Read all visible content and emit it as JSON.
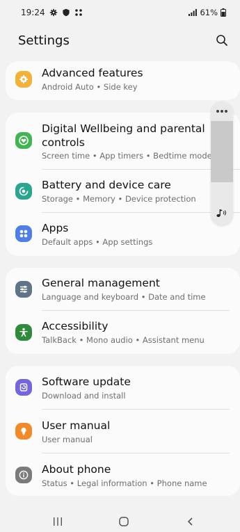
{
  "status_bar": {
    "time": "19:24",
    "battery": "61%"
  },
  "header": {
    "title": "Settings"
  },
  "settings": {
    "advanced": {
      "title": "Advanced features",
      "subtitle": "Android Auto  •  Side key"
    },
    "wellbeing": {
      "title_line1": "Digital Wellbeing and parental",
      "title_line2": "controls",
      "subtitle": "Screen time  •  App timers  •  Bedtime mode"
    },
    "battery": {
      "title": "Battery and device care",
      "subtitle": "Storage  •  Memory  •  Device protection"
    },
    "apps": {
      "title": "Apps",
      "subtitle": "Default apps  •  App settings"
    },
    "general": {
      "title": "General management",
      "subtitle": "Language and keyboard  •  Date and time"
    },
    "accessibility": {
      "title": "Accessibility",
      "subtitle": "TalkBack  •  Mono audio  •  Assistant menu"
    },
    "software": {
      "title": "Software update",
      "subtitle": "Download and install"
    },
    "manual": {
      "title": "User manual",
      "subtitle": "User manual"
    },
    "about": {
      "title": "About phone",
      "subtitle": "Status  •  Legal information  •  Phone name"
    }
  },
  "colors": {
    "advanced": "#f2b23a",
    "wellbeing": "#41b551",
    "battery": "#2aa58f",
    "apps": "#4f7ee8",
    "general": "#5f7486",
    "accessibility": "#2f8a3b",
    "software": "#7166e0",
    "manual": "#f08a2b",
    "about": "#7b7b7b"
  },
  "icons": {
    "advanced": "puzzle-gear-icon",
    "wellbeing": "heart-ring-icon",
    "battery": "device-care-icon",
    "apps": "apps-grid-icon",
    "general": "sliders-icon",
    "accessibility": "accessibility-person-icon",
    "software": "update-icon",
    "manual": "lightbulb-icon",
    "about": "info-icon"
  }
}
